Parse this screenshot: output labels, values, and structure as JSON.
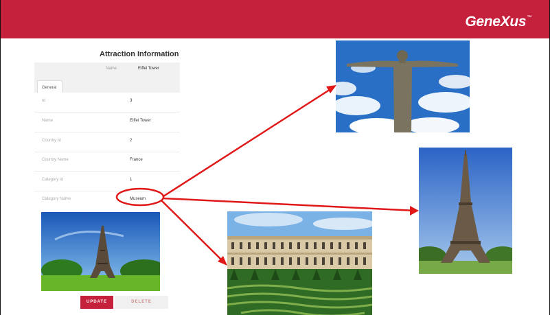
{
  "header": {
    "logo_text": "GeneXus",
    "logo_mark": "™",
    "brand_color": "#c5203c"
  },
  "form": {
    "title": "Attraction Information",
    "name_label": "Name",
    "name_value": "Eiffel Tower",
    "tab_label": "General",
    "fields": [
      {
        "label": "Id",
        "value": "3"
      },
      {
        "label": "Name",
        "value": "Eiffel Tower"
      },
      {
        "label": "Country Id",
        "value": "2"
      },
      {
        "label": "Country Name",
        "value": "France"
      },
      {
        "label": "Category Id",
        "value": "1"
      },
      {
        "label": "Category Name",
        "value": "Museum"
      }
    ],
    "update_label": "UPDATE",
    "delete_label": "DELETE"
  },
  "annotation": {
    "arrow_color": "#e01818"
  }
}
